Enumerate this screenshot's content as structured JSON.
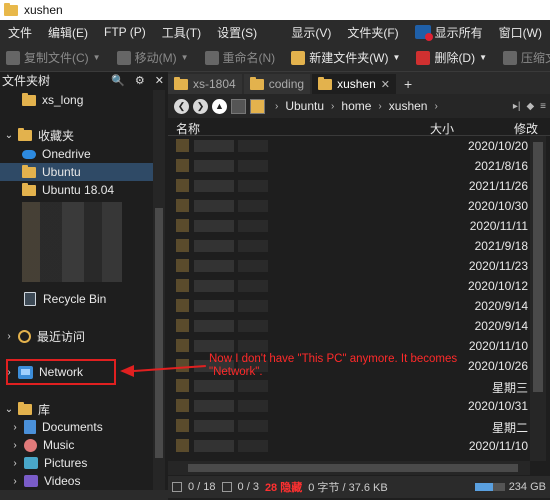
{
  "window": {
    "title": "xushen"
  },
  "menubar": {
    "left": [
      "文件",
      "编辑(E)",
      "FTP (P)",
      "工具(T)",
      "设置(S)"
    ],
    "right": [
      "显示(V)",
      "文件夹(F)"
    ],
    "show_all": "显示所有",
    "window_menu": "窗口(W)"
  },
  "toolbar": {
    "copy": "复制文件(C)",
    "move": "移动(M)",
    "rename": "重命名(N)",
    "new_folder": "新建文件夹(W)",
    "delete": "删除(D)",
    "compress": "压缩文件"
  },
  "left_pane": {
    "header": "文件夹树",
    "tree": {
      "xs_long": "xs_long",
      "favorites": "收藏夹",
      "onedrive": "Onedrive",
      "ubuntu": "Ubuntu",
      "ubuntu1804": "Ubuntu 18.04",
      "recycle": "Recycle Bin",
      "recent": "最近访问",
      "network": "Network",
      "library": "库",
      "documents": "Documents",
      "music": "Music",
      "pictures": "Pictures",
      "videos": "Videos"
    }
  },
  "tabs": [
    "xs-1804",
    "coding",
    "xushen"
  ],
  "address": {
    "crumbs": [
      "Ubuntu",
      "home",
      "xushen"
    ]
  },
  "columns": {
    "name": "名称",
    "size": "大小",
    "modified": "修改"
  },
  "rows": [
    "2020/10/20",
    "2021/8/16",
    "2021/11/26",
    "2020/10/30",
    "2020/11/11",
    "2021/9/18",
    "2020/11/23",
    "2020/10/12",
    "2020/9/14",
    "2020/9/14",
    "2020/11/10",
    "2020/10/26",
    "星期三",
    "2020/10/31",
    "星期二",
    "2020/11/10"
  ],
  "status": {
    "files": "0 / 18",
    "folders": "0 / 3",
    "hidden": "28 隐藏",
    "bytes": "0 字节 / 37.6 KB",
    "disk": "234 GB",
    "disk_used_fraction": 0.6
  },
  "annotation": {
    "text": "Now I don't have \"This PC\" anymore. It becomes \"Network\".",
    "color": "#e02020"
  }
}
